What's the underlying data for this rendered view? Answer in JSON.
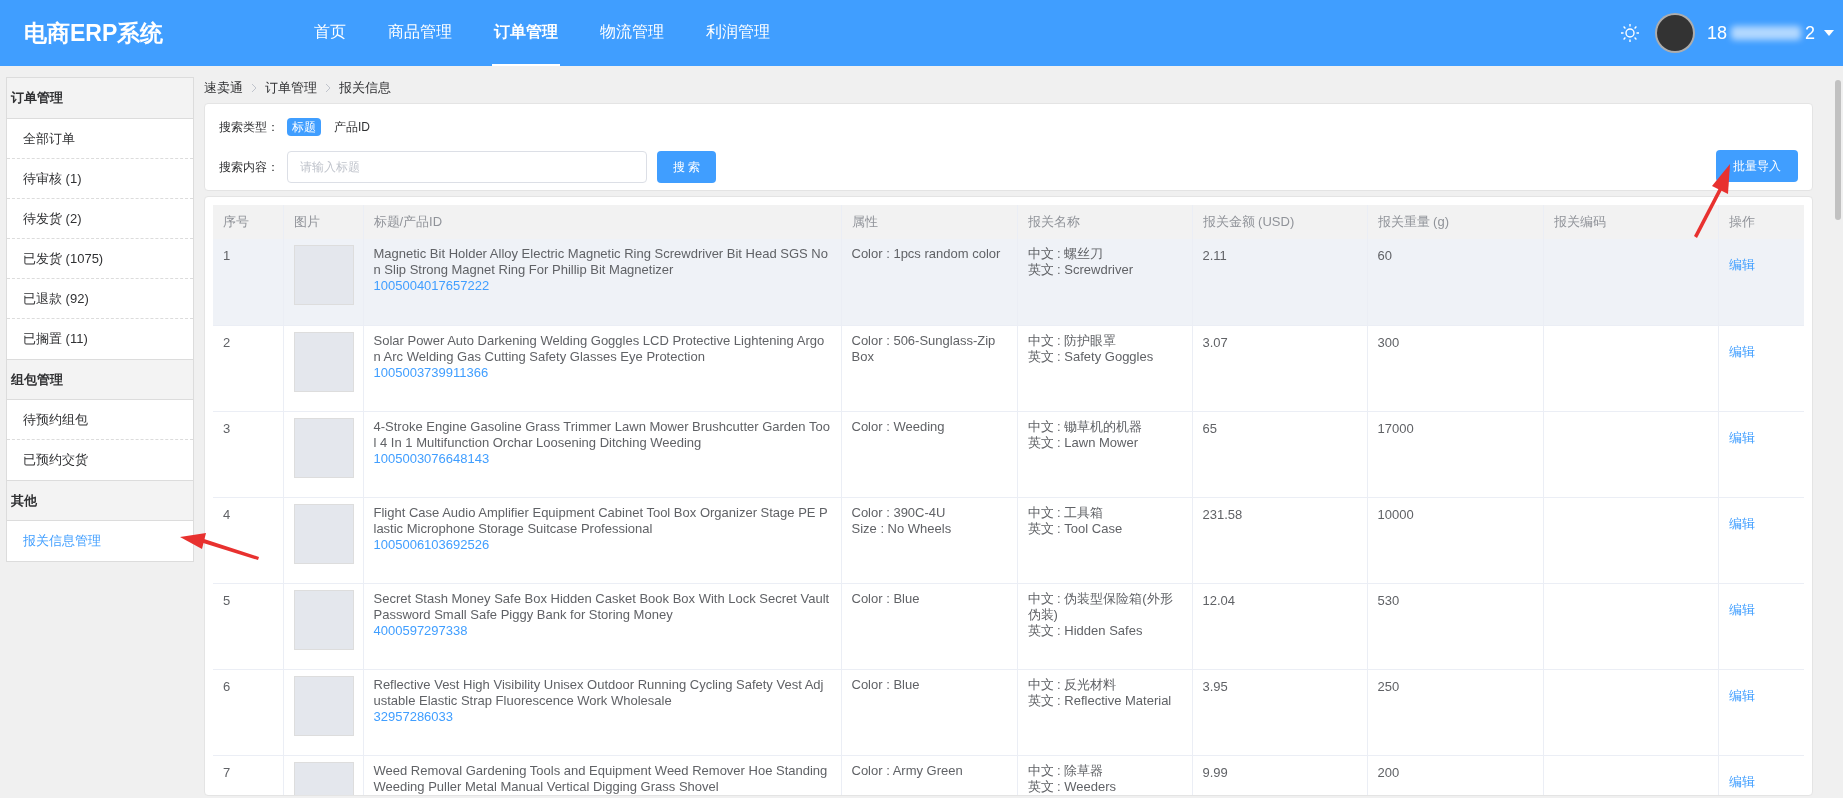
{
  "header": {
    "logo": "电商ERP系统",
    "nav": [
      {
        "label": "首页",
        "selected": false
      },
      {
        "label": "商品管理",
        "selected": false
      },
      {
        "label": "订单管理",
        "selected": true
      },
      {
        "label": "物流管理",
        "selected": false
      },
      {
        "label": "利润管理",
        "selected": false
      }
    ],
    "user_start": "18",
    "user_end": "2"
  },
  "sidebar": [
    {
      "title": "订单管理",
      "items": [
        {
          "label": "全部订单",
          "selected": false
        },
        {
          "label": "待审核 (1)",
          "selected": false
        },
        {
          "label": "待发货 (2)",
          "selected": false
        },
        {
          "label": "已发货 (1075)",
          "selected": false
        },
        {
          "label": "已退款 (92)",
          "selected": false
        },
        {
          "label": "已搁置 (11)",
          "selected": false
        }
      ]
    },
    {
      "title": "组包管理",
      "items": [
        {
          "label": "待预约组包",
          "selected": false
        },
        {
          "label": "已预约交货",
          "selected": false
        }
      ]
    },
    {
      "title": "其他",
      "items": [
        {
          "label": "报关信息管理",
          "selected": true
        }
      ]
    }
  ],
  "breadcrumb": [
    "速卖通",
    "订单管理",
    "报关信息"
  ],
  "search": {
    "type_label": "搜索类型：",
    "types": [
      {
        "label": "标题",
        "selected": true
      },
      {
        "label": "产品ID",
        "selected": false
      }
    ],
    "content_label": "搜索内容：",
    "placeholder": "请输入标题",
    "button": "搜 索",
    "import_button": "批量导入"
  },
  "table": {
    "columns": [
      "序号",
      "图片",
      "标题/产品ID",
      "属性",
      "报关名称",
      "报关金额 (USD)",
      "报关重量 (g)",
      "报关编码",
      "操作"
    ],
    "rows": [
      {
        "index": "1",
        "title": "Magnetic Bit Holder Alloy Electric Magnetic Ring Screwdriver Bit Head SGS Non Slip Strong Magnet Ring For Phillip Bit Magnetizer",
        "product_id": "1005004017657222",
        "attributes": [
          "Color : 1pcs random color"
        ],
        "customs_name": [
          "中文 : 螺丝刀",
          "英文 : Screwdriver"
        ],
        "amount": "2.11",
        "weight": "60",
        "action": "编辑",
        "hovered": true
      },
      {
        "index": "2",
        "title": "Solar Power Auto Darkening Welding Goggles LCD Protective Lightening Argon Arc Welding Gas Cutting Safety Glasses Eye Protection",
        "product_id": "1005003739911366",
        "attributes": [
          "Color : 506-Sunglass-Zip Box"
        ],
        "customs_name": [
          "中文 : 防护眼罩",
          "英文 : Safety Goggles"
        ],
        "amount": "3.07",
        "weight": "300",
        "action": "编辑",
        "hovered": false
      },
      {
        "index": "3",
        "title": "4-Stroke Engine Gasoline Grass Trimmer Lawn Mower Brushcutter Garden Tool 4 In 1 Multifunction Orchar Loosening Ditching Weeding",
        "product_id": "1005003076648143",
        "attributes": [
          "Color : Weeding"
        ],
        "customs_name": [
          "中文 : 锄草机的机器",
          "英文 : Lawn Mower"
        ],
        "amount": "65",
        "weight": "17000",
        "action": "编辑",
        "hovered": false
      },
      {
        "index": "4",
        "title": "Flight Case Audio Amplifier Equipment Cabinet Tool Box Organizer Stage PE Plastic Microphone Storage Suitcase Professional",
        "product_id": "1005006103692526",
        "attributes": [
          "Color : 390C-4U",
          "Size : No Wheels"
        ],
        "customs_name": [
          "中文 : 工具箱",
          "英文 : Tool Case"
        ],
        "amount": "231.58",
        "weight": "10000",
        "action": "编辑",
        "hovered": false
      },
      {
        "index": "5",
        "title": "Secret Stash Money Safe Box Hidden Casket Book Box With Lock Secret Vault Password Small Safe Piggy Bank for Storing Money",
        "product_id": "4000597297338",
        "attributes": [
          "Color : Blue"
        ],
        "customs_name": [
          "中文 : 伪装型保险箱(外形伪装)",
          "英文 : Hidden Safes"
        ],
        "amount": "12.04",
        "weight": "530",
        "action": "编辑",
        "hovered": false
      },
      {
        "index": "6",
        "title": "Reflective Vest High Visibility Unisex Outdoor Running Cycling Safety Vest Adjustable Elastic Strap Fluorescence Work Wholesale",
        "product_id": "32957286033",
        "attributes": [
          "Color : Blue"
        ],
        "customs_name": [
          "中文 : 反光材料",
          "英文 : Reflective Material"
        ],
        "amount": "3.95",
        "weight": "250",
        "action": "编辑",
        "hovered": false
      },
      {
        "index": "7",
        "title": "Weed Removal Gardening Tools and Equipment Weed Remover Hoe Standing Weeding Puller Metal Manual Vertical Digging Grass Shovel",
        "attributes": [
          "Color : Army Green"
        ],
        "customs_name": [
          "中文 : 除草器",
          "英文 : Weeders"
        ],
        "amount": "9.99",
        "weight": "200",
        "action": "编辑",
        "hovered": false
      }
    ]
  }
}
